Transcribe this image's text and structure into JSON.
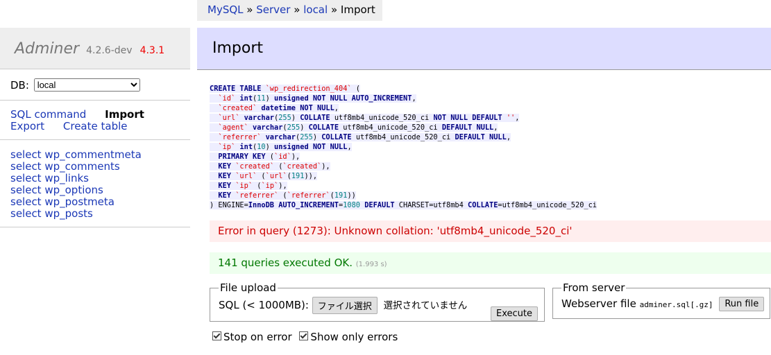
{
  "breadcrumb": {
    "mysql": "MySQL",
    "sep": "»",
    "server": "Server",
    "db": "local",
    "current": "Import"
  },
  "sidebar": {
    "app_name": "Adminer",
    "version": "4.2.6-dev",
    "new_version": "4.3.1",
    "db_label": "DB:",
    "db_selected": "local",
    "links": {
      "sql_command": "SQL command",
      "import": "Import",
      "export": "Export",
      "create_table": "Create table"
    },
    "tables": [
      "select wp_commentmeta",
      "select wp_comments",
      "select wp_links",
      "select wp_options",
      "select wp_postmeta",
      "select wp_posts"
    ]
  },
  "page": {
    "title": "Import"
  },
  "error": {
    "text": "Error in query (1273): Unknown collation: 'utf8mb4_unicode_520_ci'"
  },
  "message": {
    "text": "141 queries executed OK.",
    "time": "(1.993 s)"
  },
  "upload": {
    "legend": "File upload",
    "label": "SQL (< 1000MB):",
    "choose_button": "ファイル選択",
    "no_file": "選択されていません",
    "execute": "Execute"
  },
  "server": {
    "legend": "From server",
    "label": "Webserver file",
    "filename": "adminer.sql[.gz]",
    "run": "Run file"
  },
  "options": {
    "stop_on_error": "Stop on error",
    "only_errors": "Show only errors"
  }
}
